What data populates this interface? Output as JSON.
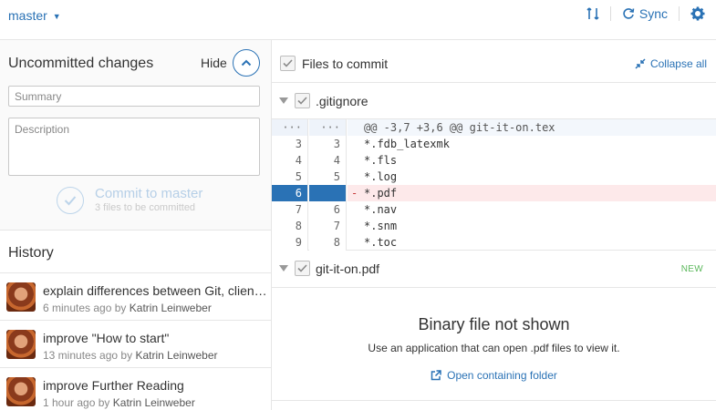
{
  "topbar": {
    "branch": "master",
    "sync_label": "Sync"
  },
  "left": {
    "uncommitted_title": "Uncommitted changes",
    "hide_label": "Hide",
    "summary_placeholder": "Summary",
    "description_placeholder": "Description",
    "commit_label": "Commit to master",
    "commit_sub": "3 files to be committed",
    "history_title": "History",
    "history": [
      {
        "title": "explain differences between Git, clien…",
        "time": "6 minutes ago",
        "by": "by",
        "author": "Katrin Leinweber"
      },
      {
        "title": "improve \"How to start\"",
        "time": "13 minutes ago",
        "by": "by",
        "author": "Katrin Leinweber"
      },
      {
        "title": "improve Further Reading",
        "time": "1 hour ago",
        "by": "by",
        "author": "Katrin Leinweber"
      }
    ]
  },
  "right": {
    "files_label": "Files to commit",
    "collapse_label": "Collapse all",
    "file1": {
      "name": ".gitignore",
      "diff": [
        {
          "a": "···",
          "b": "···",
          "m": "",
          "code": "@@ -3,7 +3,6 @@ git-it-on.tex",
          "type": "hunk"
        },
        {
          "a": "3",
          "b": "3",
          "m": "",
          "code": "*.fdb_latexmk",
          "type": "ctx"
        },
        {
          "a": "4",
          "b": "4",
          "m": "",
          "code": "*.fls",
          "type": "ctx"
        },
        {
          "a": "5",
          "b": "5",
          "m": "",
          "code": "*.log",
          "type": "ctx"
        },
        {
          "a": "6",
          "b": "",
          "m": "-",
          "code": "*.pdf",
          "type": "removed"
        },
        {
          "a": "7",
          "b": "6",
          "m": "",
          "code": "*.nav",
          "type": "ctx"
        },
        {
          "a": "8",
          "b": "7",
          "m": "",
          "code": "*.snm",
          "type": "ctx"
        },
        {
          "a": "9",
          "b": "8",
          "m": "",
          "code": "*.toc",
          "type": "ctx"
        }
      ]
    },
    "file2": {
      "name": "git-it-on.pdf",
      "badge": "NEW",
      "binary_title": "Binary file not shown",
      "binary_sub": "Use an application that can open .pdf files to view it.",
      "open_folder": "Open containing folder"
    }
  },
  "colors": {
    "accent": "#2a72b5",
    "removed_bg": "#fde9ea",
    "new_badge": "#5cb85c"
  },
  "icons": [
    "chevron-down-icon",
    "compare-branch-icon",
    "sync-icon",
    "gear-icon",
    "chevron-up-icon",
    "checkmark-icon",
    "collapse-icon",
    "disclosure-triangle-icon",
    "external-link-icon"
  ]
}
